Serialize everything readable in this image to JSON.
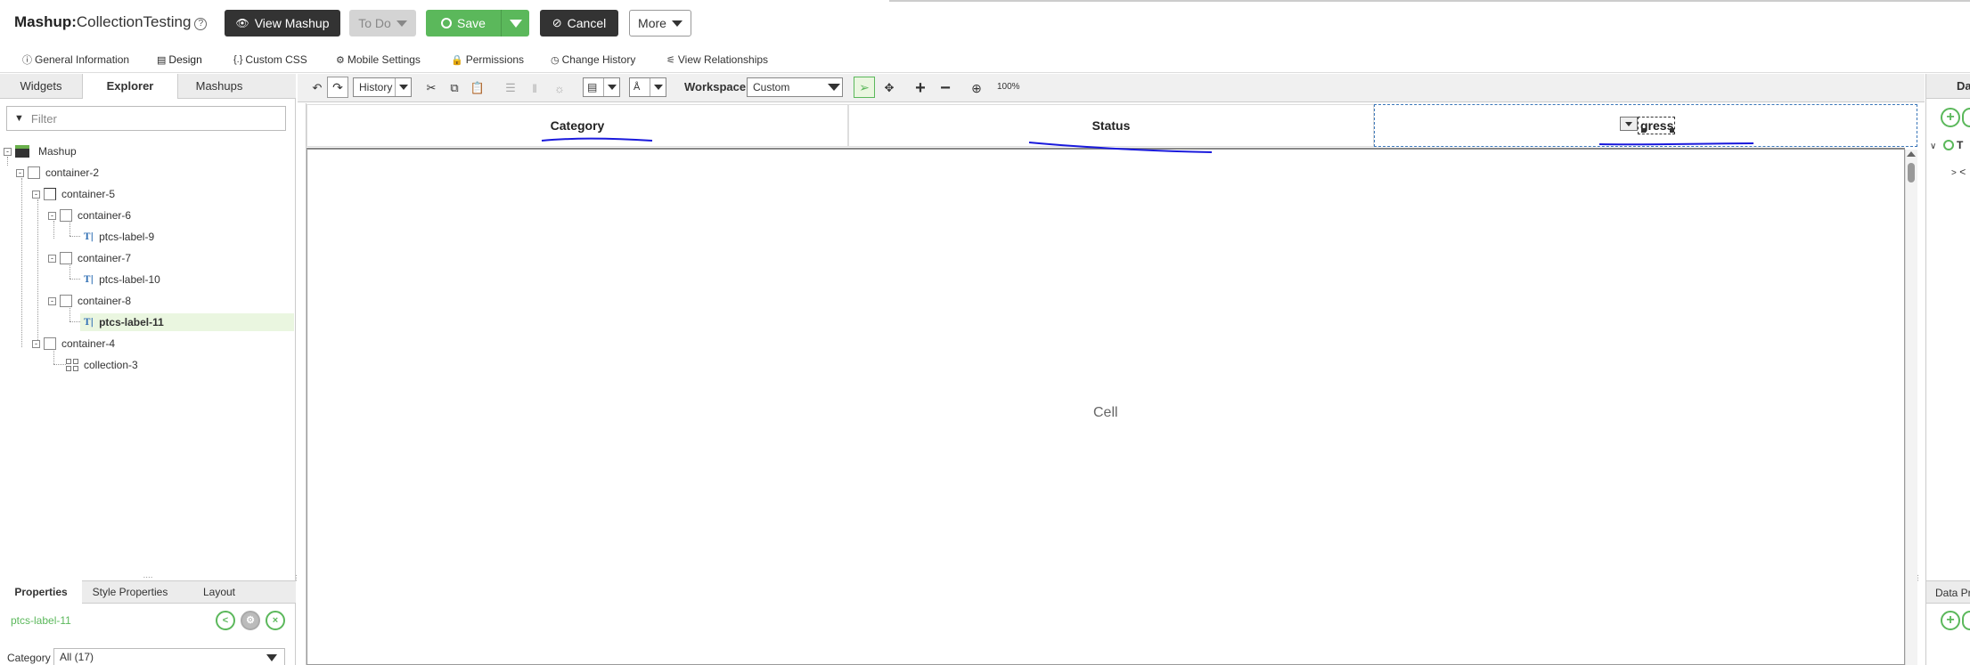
{
  "header": {
    "title_prefix": "Mashup:",
    "title_name": "CollectionTesting",
    "info_icon": "info-icon",
    "view_mashup_label": "View Mashup",
    "todo_label": "To Do",
    "save_label": "Save",
    "cancel_label": "Cancel",
    "more_label": "More"
  },
  "tabs": [
    {
      "label": "General Information",
      "icon": "info-icon"
    },
    {
      "label": "Design",
      "icon": "design-icon"
    },
    {
      "label": "Custom CSS",
      "icon": "braces-icon"
    },
    {
      "label": "Mobile Settings",
      "icon": "gear-icon"
    },
    {
      "label": "Permissions",
      "icon": "lock-icon"
    },
    {
      "label": "Change History",
      "icon": "clock-icon"
    },
    {
      "label": "View Relationships",
      "icon": "network-icon"
    }
  ],
  "left_panel": {
    "tabs": [
      "Widgets",
      "Explorer",
      "Mashups"
    ],
    "active_tab": "Explorer",
    "filter_placeholder": "Filter",
    "tree": {
      "root": "Mashup",
      "n_container2": "container-2",
      "n_container5": "container-5",
      "n_container6": "container-6",
      "n_label9": "ptcs-label-9",
      "n_container7": "container-7",
      "n_label10": "ptcs-label-10",
      "n_container8": "container-8",
      "n_label11": "ptcs-label-11",
      "n_container4": "container-4",
      "n_collection3": "collection-3"
    },
    "selected": "ptcs-label-11"
  },
  "properties": {
    "tabs": [
      "Properties",
      "Style Properties",
      "Layout"
    ],
    "active_tab": "Properties",
    "selected_widget": "ptcs-label-11",
    "category_label": "Category",
    "category_value": "All (17)"
  },
  "toolbar": {
    "history_label": "History",
    "workspace_label": "Workspace",
    "workspace_value": "Custom",
    "zoom": "100%"
  },
  "canvas": {
    "col_category": "Category",
    "col_status": "Status",
    "col_progress": "gress",
    "cell_text": "Cell"
  },
  "right_panel": {
    "tab_label": "Da",
    "row1_label": "T",
    "row2_label": "<",
    "data_properties_label": "Data Pr"
  },
  "colors": {
    "accent_green": "#5bb85b",
    "dark_button": "#333333",
    "annotation_blue": "#1a1adc"
  }
}
